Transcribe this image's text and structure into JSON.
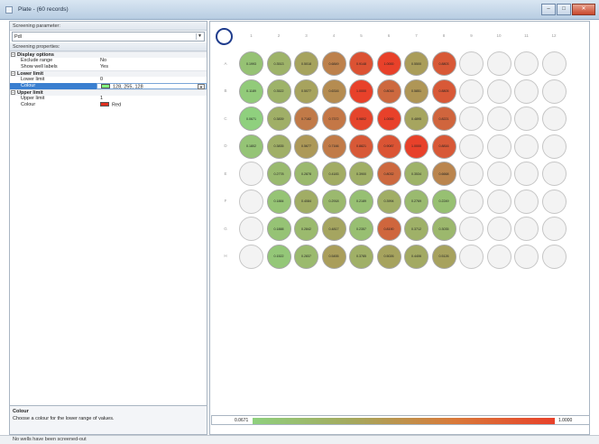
{
  "window": {
    "title": "Plate - (60 records)"
  },
  "screening": {
    "parameter_label": "Screening parameter:",
    "parameter_value": "Pdl",
    "properties_label": "Screening properties:"
  },
  "properties": {
    "display": {
      "title": "Display options",
      "exclude_range": {
        "key": "Exclude range",
        "value": "No"
      },
      "show_labels": {
        "key": "Show well labels",
        "value": "Yes"
      }
    },
    "lower": {
      "title": "Lower limit",
      "limit": {
        "key": "Lower limit",
        "value": "0"
      },
      "colour": {
        "key": "Colour",
        "value": "128, 255, 128",
        "swatch": "#80ff80"
      }
    },
    "upper": {
      "title": "Upper limit",
      "limit": {
        "key": "Upper limit",
        "value": "1"
      },
      "colour": {
        "key": "Colour",
        "value": "Red",
        "swatch": "#e03020"
      }
    }
  },
  "help": {
    "title": "Colour",
    "desc": "Choose a colour for the lower range of values."
  },
  "plate": {
    "columns": [
      "1",
      "2",
      "3",
      "4",
      "5",
      "6",
      "7",
      "8",
      "9",
      "10",
      "11",
      "12"
    ],
    "rows": [
      "A",
      "B",
      "C",
      "D",
      "E",
      "F",
      "G",
      "H"
    ],
    "wells": [
      [
        "0.1993",
        "0.3513",
        "0.5018",
        "0.6849",
        "0.9148",
        "1.0000",
        "0.5500",
        "0.8803",
        null,
        null,
        null,
        null
      ],
      [
        "0.1189",
        "0.3522",
        "0.5077",
        "0.6316",
        "1.0000",
        "0.8016",
        "0.5851",
        "0.8805",
        null,
        null,
        null,
        null
      ],
      [
        "0.0671",
        "0.3839",
        "0.7182",
        "0.7372",
        "0.9802",
        "1.0000",
        "0.4895",
        "0.8221",
        null,
        null,
        null,
        null
      ],
      [
        "0.1802",
        "0.3835",
        "0.5677",
        "0.7166",
        "0.8821",
        "0.9087",
        "1.0000",
        "0.8816",
        null,
        null,
        null,
        null
      ],
      [
        null,
        "0.2778",
        "0.2878",
        "0.4183",
        "0.3900",
        "0.8032",
        "0.3534",
        "0.6668",
        null,
        null,
        null,
        null
      ],
      [
        null,
        "0.1884",
        "0.4084",
        "0.2918",
        "0.2189",
        "0.3994",
        "0.2769",
        "0.2249",
        null,
        null,
        null,
        null
      ],
      [
        null,
        "0.1888",
        "0.2842",
        "0.4817",
        "0.2357",
        "0.8190",
        "0.3712",
        "0.3035",
        null,
        null,
        null,
        null
      ],
      [
        null,
        "0.1522",
        "0.2837",
        "0.5455",
        "0.3785",
        "0.5026",
        "0.4406",
        "0.5126",
        null,
        null,
        null,
        null
      ]
    ],
    "legend_min": "0.0671",
    "legend_max": "1.0000"
  },
  "status": "No wells have been screened-out",
  "colors": {
    "low": "#8fd07e",
    "high": "#e8412a"
  }
}
